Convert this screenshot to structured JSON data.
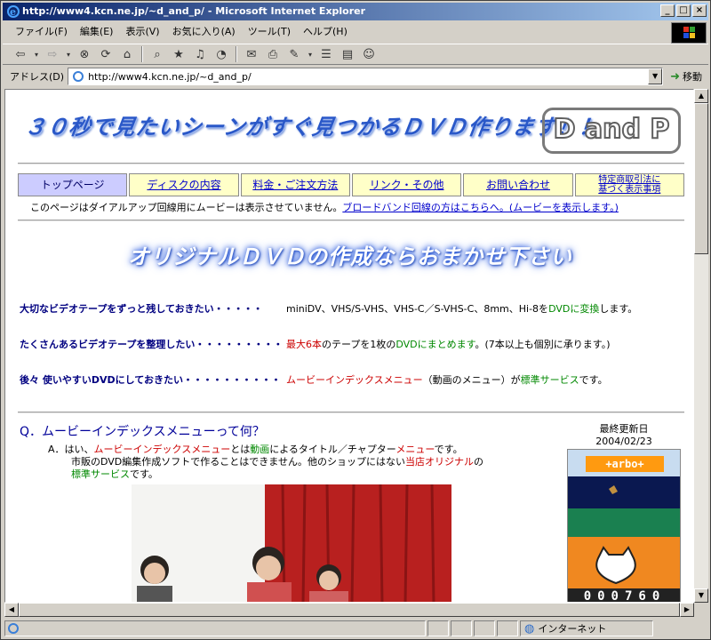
{
  "window": {
    "title": "http://www4.kcn.ne.jp/~d_and_p/ - Microsoft Internet Explorer",
    "min": "_",
    "max": "□",
    "close": "×"
  },
  "menu": {
    "items": [
      "ファイル(F)",
      "編集(E)",
      "表示(V)",
      "お気に入り(A)",
      "ツール(T)",
      "ヘルプ(H)"
    ]
  },
  "address": {
    "label": "アドレス(D)",
    "url": "http://www4.kcn.ne.jp/~d_and_p/",
    "go_label": "移動"
  },
  "header": {
    "title": "３０秒で見たいシーンがすぐ見つかるＤＶＤ作ります！！",
    "logo_text": "D and P"
  },
  "nav": [
    {
      "label": "トップページ"
    },
    {
      "label": "ディスクの内容"
    },
    {
      "label": "料金・ご注文方法"
    },
    {
      "label": "リンク・その他"
    },
    {
      "label": "お問い合わせ"
    },
    {
      "label_line1": "特定商取引法に",
      "label_line2": "基づく表示事項"
    }
  ],
  "notice": {
    "text": "このページはダイアルアップ回線用にムービーは表示させていません。",
    "link": "ブロードバンド回線の方はこちらへ。(ムービーを表示します。)"
  },
  "banner": "オリジナルＤＶＤの作成ならおまかせ下さい",
  "features": [
    {
      "left": "大切なビデオテープをずっと残しておきたい・・・・・",
      "right_a": "miniDV、VHS/S-VHS、VHS-C／S-VHS-C、8mm、Hi-8を",
      "right_b": "DVDに変換",
      "right_c": "します。"
    },
    {
      "left": "たくさんあるビデオテープを整理したい・・・・・・・・・",
      "right_a": "最大6本",
      "right_b": "のテープを1枚の",
      "right_c": "DVDにまとめます",
      "right_d": "。(7本以上も個別に承ります。)"
    },
    {
      "left": "後々 使いやすいDVDにしておきたい・・・・・・・・・・",
      "right_a": "ムービーインデックスメニュー",
      "right_b": "（動画のメニュー）が",
      "right_c": "標準サービス",
      "right_d": "です。"
    }
  ],
  "question": {
    "title": "Q．ムービーインデックスメニューって何？",
    "a_prefix": "A．はい、",
    "a_red1": "ムービーインデックスメニュー",
    "a_text1": "とは",
    "a_green1": "動画",
    "a_text2": "によるタイトル／チャプター",
    "a_red2": "メニュー",
    "a_text3": "です。",
    "line2": "市販のDVD編集作成ソフトで作ることはできません。他のショップにはない",
    "line2_red": "当店オリジナル",
    "line2_end": "の",
    "line3_green": "標準サービス",
    "line3_end": "です。"
  },
  "updated": {
    "label": "最終更新日",
    "date": "2004/02/23"
  },
  "counter": {
    "brand": "+arbo+",
    "digits": "000760"
  },
  "status": {
    "zone": "インターネット"
  }
}
